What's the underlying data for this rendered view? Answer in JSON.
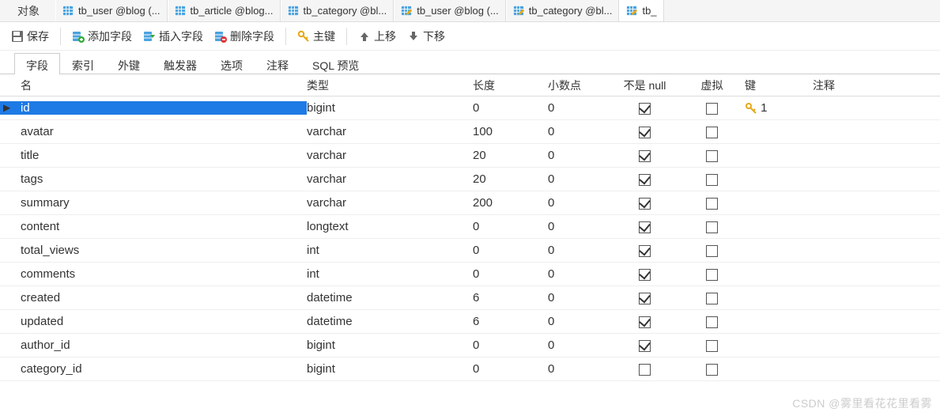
{
  "tabs": {
    "object_label": "对象",
    "items": [
      {
        "label": "tb_user @blog (...",
        "pencil": false
      },
      {
        "label": "tb_article @blog...",
        "pencil": false
      },
      {
        "label": "tb_category @bl...",
        "pencil": false
      },
      {
        "label": "tb_user @blog (...",
        "pencil": true
      },
      {
        "label": "tb_category @bl...",
        "pencil": true
      },
      {
        "label": "tb_",
        "pencil": true
      }
    ]
  },
  "toolbar": {
    "save": "保存",
    "add_field": "添加字段",
    "insert_field": "插入字段",
    "delete_field": "删除字段",
    "primary_key": "主键",
    "move_up": "上移",
    "move_down": "下移"
  },
  "subtabs": {
    "items": [
      "字段",
      "索引",
      "外键",
      "触发器",
      "选项",
      "注释",
      "SQL 预览"
    ],
    "active": 0
  },
  "grid": {
    "headers": {
      "name": "名",
      "type": "类型",
      "length": "长度",
      "decimals": "小数点",
      "not_null": "不是 null",
      "virtual": "虚拟",
      "key": "键",
      "comment": "注释"
    },
    "rows": [
      {
        "name": "id",
        "type": "bigint",
        "length": "0",
        "decimals": "0",
        "not_null": true,
        "virtual": false,
        "key": "1",
        "selected": true
      },
      {
        "name": "avatar",
        "type": "varchar",
        "length": "100",
        "decimals": "0",
        "not_null": true,
        "virtual": false,
        "key": ""
      },
      {
        "name": "title",
        "type": "varchar",
        "length": "20",
        "decimals": "0",
        "not_null": true,
        "virtual": false,
        "key": ""
      },
      {
        "name": "tags",
        "type": "varchar",
        "length": "20",
        "decimals": "0",
        "not_null": true,
        "virtual": false,
        "key": ""
      },
      {
        "name": "summary",
        "type": "varchar",
        "length": "200",
        "decimals": "0",
        "not_null": true,
        "virtual": false,
        "key": ""
      },
      {
        "name": "content",
        "type": "longtext",
        "length": "0",
        "decimals": "0",
        "not_null": true,
        "virtual": false,
        "key": ""
      },
      {
        "name": "total_views",
        "type": "int",
        "length": "0",
        "decimals": "0",
        "not_null": true,
        "virtual": false,
        "key": ""
      },
      {
        "name": "comments",
        "type": "int",
        "length": "0",
        "decimals": "0",
        "not_null": true,
        "virtual": false,
        "key": ""
      },
      {
        "name": "created",
        "type": "datetime",
        "length": "6",
        "decimals": "0",
        "not_null": true,
        "virtual": false,
        "key": ""
      },
      {
        "name": "updated",
        "type": "datetime",
        "length": "6",
        "decimals": "0",
        "not_null": true,
        "virtual": false,
        "key": ""
      },
      {
        "name": "author_id",
        "type": "bigint",
        "length": "0",
        "decimals": "0",
        "not_null": true,
        "virtual": false,
        "key": ""
      },
      {
        "name": "category_id",
        "type": "bigint",
        "length": "0",
        "decimals": "0",
        "not_null": false,
        "virtual": false,
        "key": ""
      }
    ]
  },
  "watermark": "CSDN @雾里看花花里看雾"
}
